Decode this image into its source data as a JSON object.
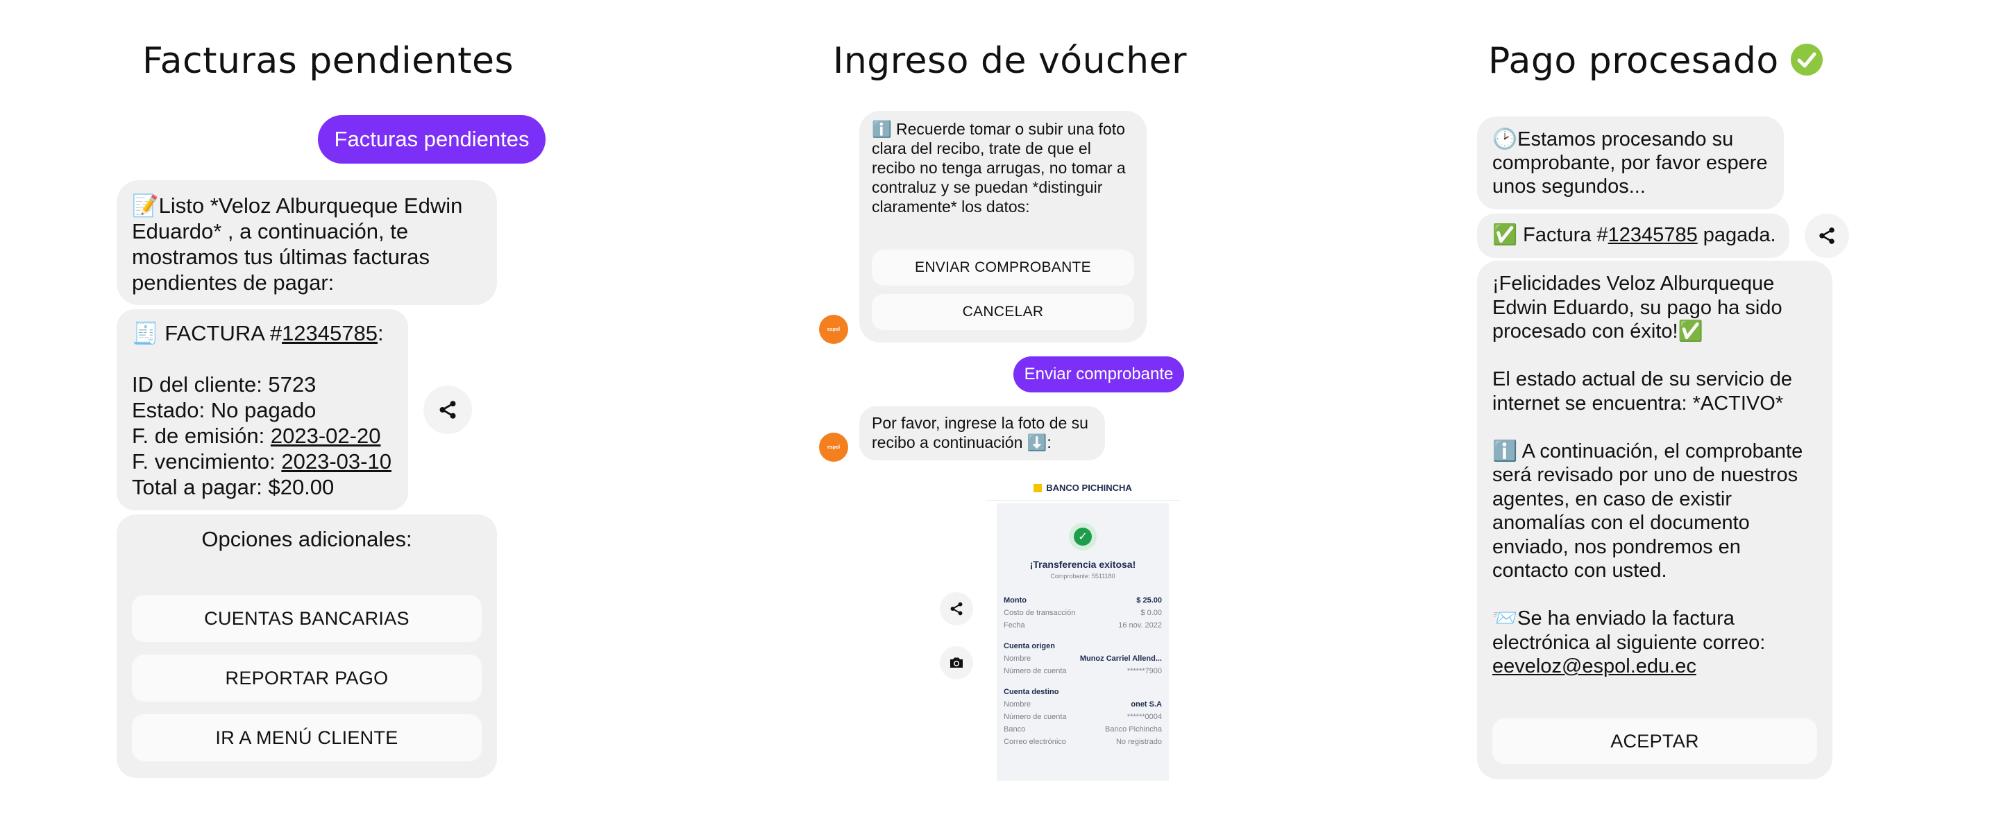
{
  "panels": {
    "left_title": "Facturas pendientes",
    "middle_title": "Ingreso de vóucher",
    "right_title": "Pago procesado"
  },
  "left": {
    "user_msg": "Facturas pendientes",
    "intro_emoji": "📝",
    "intro": "Listo *Veloz Alburqueque Edwin Eduardo* , a continuación, te mostramos tus últimas facturas pendientes de pagar:",
    "invoice": {
      "emoji": "🧾",
      "prefix": "FACTURA #",
      "number": "12345785",
      "suffix": ":",
      "client_id": "ID del cliente: 5723",
      "status": "Estado: No pagado",
      "issue_label": "F. de emisión: ",
      "issue_date": "2023-02-20",
      "due_label": "F. vencimiento: ",
      "due_date": "2023-03-10",
      "total": "Total a pagar: $20.00"
    },
    "options_title": "Opciones adicionales:",
    "buttons": [
      "CUENTAS BANCARIAS",
      "REPORTAR PAGO",
      "IR A MENÚ CLIENTE"
    ]
  },
  "middle": {
    "info_emoji": "ℹ️",
    "info": "Recuerde tomar o subir una foto clara del recibo, trate de que el recibo no tenga arrugas, no tomar a contraluz y se puedan *distinguir claramente* los datos:",
    "btn_send": "ENVIAR COMPROBANTE",
    "btn_cancel": "CANCELAR",
    "user_msg": "Enviar comprobante",
    "prompt": "Por favor, ingrese la foto de su recibo a continuación",
    "prompt_emoji": "⬇️",
    "avatar_text": "espol",
    "receipt": {
      "bank": "BANCO PICHINCHA",
      "headline": "¡Transferencia exitosa!",
      "voucher": "Comprobante: 5511180",
      "rows": [
        {
          "label": "Monto",
          "value": "$ 25.00",
          "bold": true
        },
        {
          "label": "Costo de transacción",
          "value": "$ 0.00"
        },
        {
          "label": "Fecha",
          "value": "16 nov. 2022"
        }
      ],
      "origin_title": "Cuenta origen",
      "origin_rows": [
        {
          "label": "Nombre",
          "value": "Munoz Carriel Allend..."
        },
        {
          "label": "Número de cuenta",
          "value": "******7900"
        }
      ],
      "dest_title": "Cuenta destino",
      "dest_rows": [
        {
          "label": "Nombre",
          "value": "onet S.A"
        },
        {
          "label": "Número de cuenta",
          "value": "******0004"
        },
        {
          "label": "Banco",
          "value": "Banco Pichincha"
        },
        {
          "label": "Correo electrónico",
          "value": "No registrado"
        }
      ]
    }
  },
  "right": {
    "processing_emoji": "🕑",
    "processing": "Estamos procesando su comprobante, por favor espere unos segundos...",
    "paid_emoji": "✅",
    "paid_prefix": "Factura #",
    "paid_number": "12345785",
    "paid_suffix": " pagada.",
    "congrats": "¡Felicidades Veloz Alburqueque Edwin Eduardo, su pago ha sido procesado con éxito!",
    "status_text": "El estado actual de su servicio de internet se encuentra: *ACTIVO*",
    "review_emoji": "ℹ️",
    "review": "A continuación, el comprobante será revisado por uno de nuestros agentes, en caso de existir anomalías con el documento enviado, nos pondremos en contacto con usted.",
    "mail_emoji": "📨",
    "mail_text": "Se ha enviado la factura electrónica al siguiente correo:",
    "email": "eeveloz@espol.edu.ec",
    "accept": "ACEPTAR"
  },
  "colors": {
    "accent": "#7b2ff7",
    "bubble": "#f0f0f0",
    "avatar": "#f47f1f",
    "check": "#8dc63f"
  }
}
